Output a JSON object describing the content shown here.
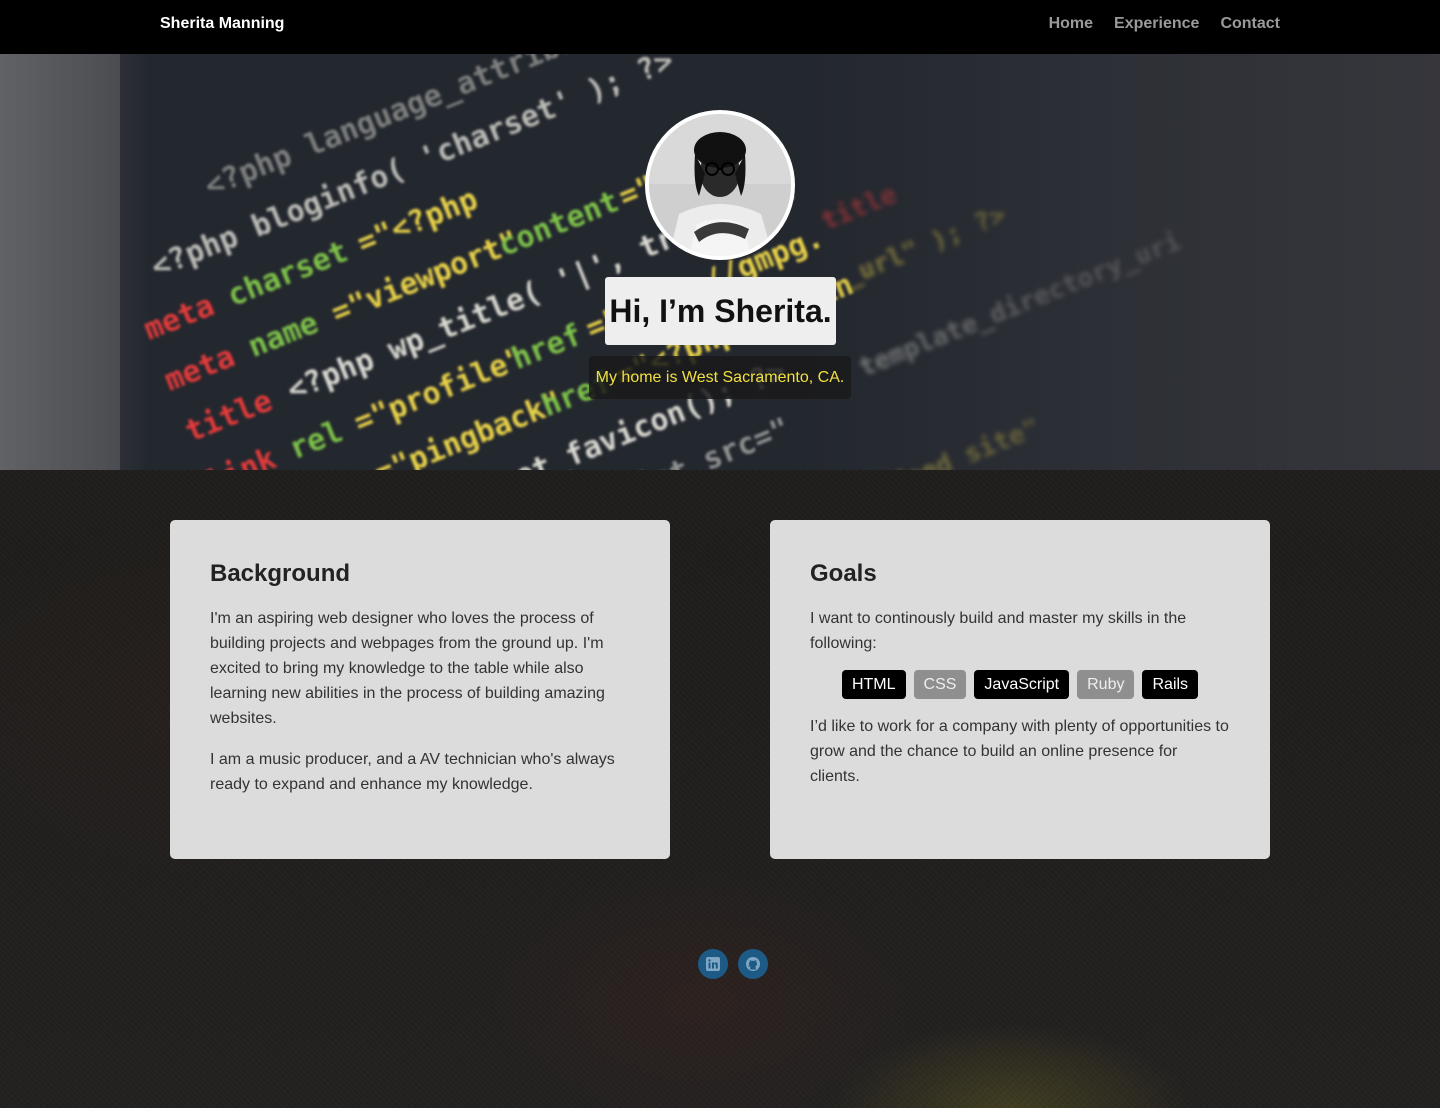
{
  "nav": {
    "brand": "Sherita Manning",
    "links": [
      "Home",
      "Experience",
      "Contact"
    ]
  },
  "hero": {
    "title": "Hi, I’m Sherita.",
    "subtitle": "My home is West Sacramento, CA.",
    "subtitle_color": "#f0e040"
  },
  "background_card": {
    "heading": "Background",
    "paragraphs": [
      "I'm an aspiring web designer who loves the process of building projects and webpages from the ground up. I'm excited to bring my knowledge to the table while also learning new abilities in the process of building amazing websites.",
      "I am a music producer, and a AV technician who's always ready to expand and enhance my knowledge."
    ]
  },
  "goals_card": {
    "heading": "Goals",
    "intro": "I want to continously build and master my skills in the following:",
    "skills": [
      "HTML",
      "CSS",
      "JavaScript",
      "Ruby",
      "Rails"
    ],
    "outro": "I’d like to work for a company with plenty of opportunities to grow and the chance to build an online presence for clients."
  },
  "social": {
    "icons": [
      "linkedin-icon",
      "github-icon"
    ],
    "color": "#1d5b86"
  }
}
